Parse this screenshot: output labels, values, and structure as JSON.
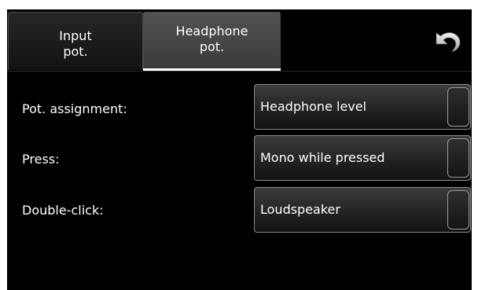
{
  "tabs": {
    "input": "Input\npot.",
    "headphone": "Headphone\npot."
  },
  "active_tab": "headphone",
  "settings": {
    "pot_assignment": {
      "label": "Pot. assignment:",
      "value": "Headphone level"
    },
    "press": {
      "label": "Press:",
      "value": "Mono while pressed"
    },
    "double_click": {
      "label": "Double-click:",
      "value": "Loudspeaker"
    }
  },
  "icons": {
    "back": "undo-arrow-icon"
  },
  "colors": {
    "background": "#000000",
    "active_tab": "#4a4a4a",
    "text": "#ffffff"
  }
}
